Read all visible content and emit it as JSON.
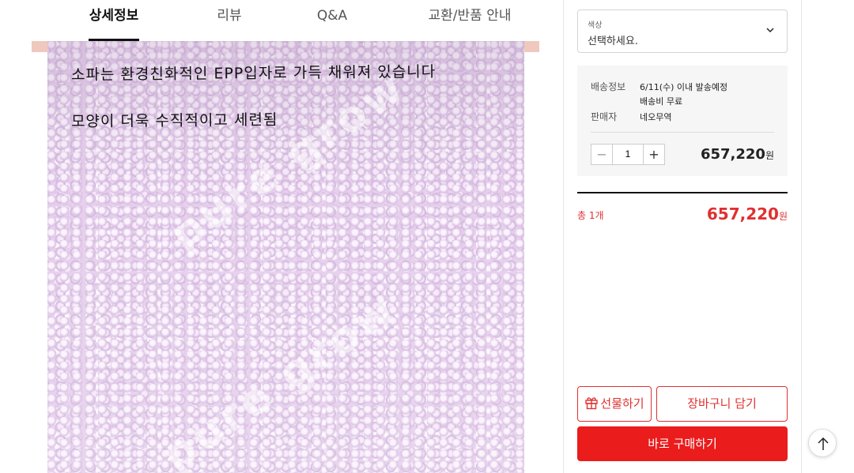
{
  "tabs": [
    {
      "label": "상세정보",
      "active": true
    },
    {
      "label": "리뷰"
    },
    {
      "label": "Q&A"
    },
    {
      "label": "교환/반품 안내"
    }
  ],
  "product_image": {
    "caption_line1": "소파는 환경친화적인 EPP입자로 가득 채워져 있습니다",
    "caption_line2": "모양이 더욱 수직적이고 세련됨",
    "watermark": "pure grow"
  },
  "option": {
    "label": "색상",
    "value": "선택하세요.",
    "icon": "chevron-down-icon"
  },
  "shipping": {
    "label": "배송정보",
    "line1": "6/11(수) 이내 발송예정",
    "line2": "배송비 무료",
    "seller_label": "판매자",
    "seller": "네오무역"
  },
  "quantity": {
    "minus": "−",
    "value": "1",
    "plus": "+"
  },
  "item_price": {
    "amount": "657,220",
    "unit": "원"
  },
  "total": {
    "label": "총 1개",
    "amount": "657,220",
    "unit": "원"
  },
  "buttons": {
    "gift": "선물하기",
    "cart": "장바구니 담기",
    "buy": "바로 구매하기"
  },
  "colors": {
    "accent": "#ea1c1c",
    "text": "#222222"
  }
}
